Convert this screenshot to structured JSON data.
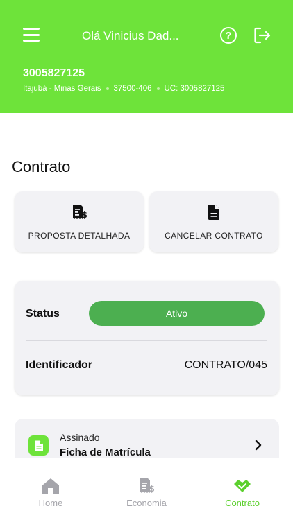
{
  "header": {
    "greeting": "Olá Vinicius Dad...",
    "uc_number": "3005827125",
    "city": "Itajubá - Minas Gerais",
    "cep": "37500-406",
    "uc_label": "UC: 3005827125",
    "help_icon": "help-circle-icon",
    "logout_icon": "logout-icon",
    "menu_icon": "hamburger-menu-icon"
  },
  "contract": {
    "title": "Contrato",
    "actions": [
      {
        "label": "PROPOSTA DETALHADA",
        "icon": "receipt-dollar-icon"
      },
      {
        "label": "CANCELAR CONTRATO",
        "icon": "document-icon"
      }
    ],
    "status_label": "Status",
    "status_value": "Ativo",
    "identifier_label": "Identificador",
    "identifier_value": "CONTRATO/045"
  },
  "document": {
    "status": "Assinado",
    "name": "Ficha de Matrícula",
    "icon": "document-icon"
  },
  "nav": {
    "items": [
      {
        "label": "Home",
        "icon": "home-icon"
      },
      {
        "label": "Economia",
        "icon": "receipt-dollar-icon"
      },
      {
        "label": "Contrato",
        "icon": "handshake-icon"
      }
    ],
    "active": "Contrato"
  },
  "colors": {
    "brand_green": "#6ee33a",
    "status_green": "#4caf50",
    "active_nav": "#5cd02e",
    "inactive_nav": "#a5a5ab"
  }
}
